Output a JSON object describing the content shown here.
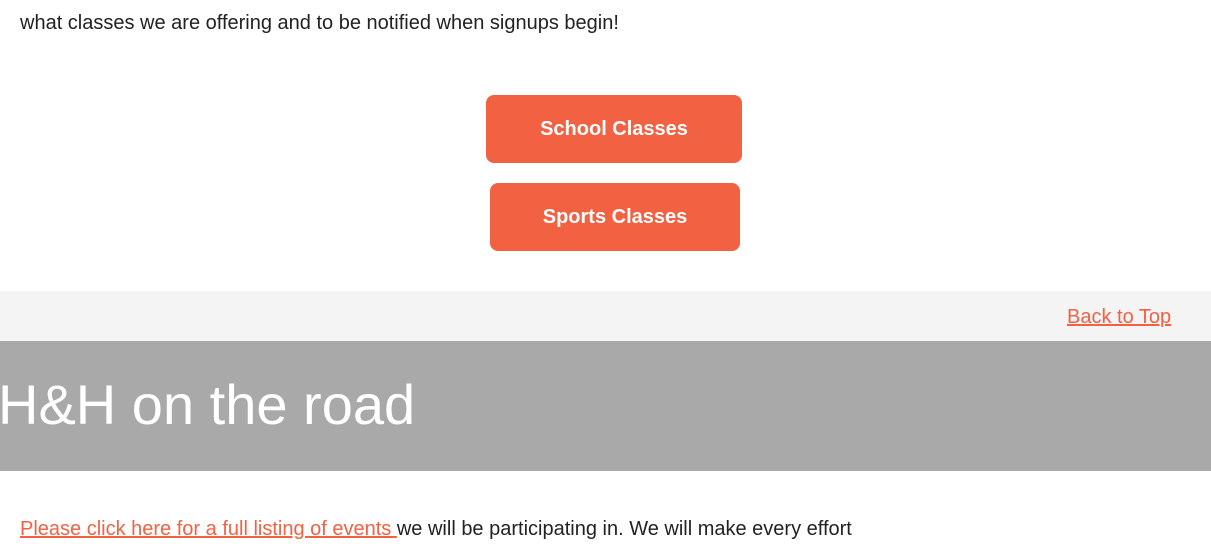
{
  "intro": {
    "text": "what classes we are offering and to be notified when signups begin!"
  },
  "buttons": {
    "school_label": "School Classes",
    "sports_label": "Sports Classes"
  },
  "nav": {
    "back_to_top": "Back to Top"
  },
  "section": {
    "title": "H&H on the road"
  },
  "events": {
    "link_text": "Please click here for a full listing of events ",
    "rest_text": "we will be participating in. We will make every effort"
  },
  "colors": {
    "accent": "#f26142",
    "header_bg": "#a9a9a9",
    "bar_bg": "#f4f4f4"
  }
}
